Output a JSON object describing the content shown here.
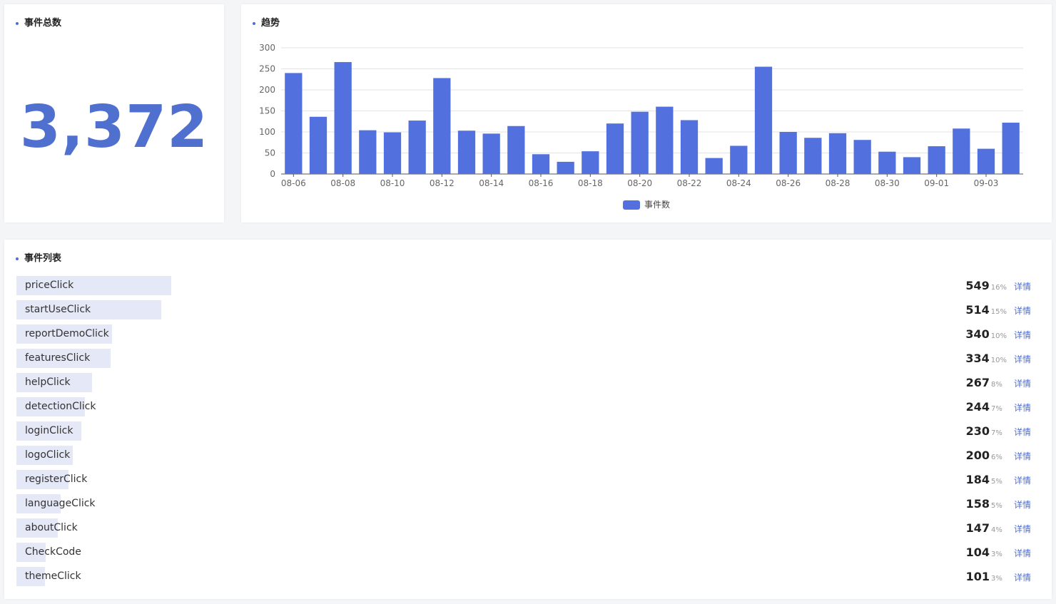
{
  "total_card": {
    "title": "事件总数",
    "value": "3,372"
  },
  "trend_card": {
    "title": "趋势"
  },
  "chart_data": {
    "type": "bar",
    "categories": [
      "08-06",
      "08-07",
      "08-08",
      "08-09",
      "08-10",
      "08-11",
      "08-12",
      "08-13",
      "08-14",
      "08-15",
      "08-16",
      "08-17",
      "08-18",
      "08-19",
      "08-20",
      "08-21",
      "08-22",
      "08-23",
      "08-24",
      "08-25",
      "08-26",
      "08-27",
      "08-28",
      "08-29",
      "08-30",
      "08-31",
      "09-01",
      "09-02",
      "09-03",
      "09-04"
    ],
    "tick_labels": [
      "08-06",
      "08-08",
      "08-10",
      "08-12",
      "08-14",
      "08-16",
      "08-18",
      "08-20",
      "08-22",
      "08-24",
      "08-26",
      "08-28",
      "08-30",
      "09-01",
      "09-03"
    ],
    "series": [
      {
        "name": "事件数",
        "values": [
          240,
          136,
          266,
          104,
          99,
          127,
          228,
          103,
          96,
          114,
          47,
          29,
          54,
          120,
          148,
          160,
          128,
          38,
          67,
          255,
          100,
          86,
          97,
          81,
          53,
          40,
          66,
          108,
          60,
          122
        ]
      }
    ],
    "ylim": [
      0,
      300
    ],
    "yticks": [
      0,
      50,
      100,
      150,
      200,
      250,
      300
    ],
    "grid": true,
    "legend": "bottom-center",
    "color": "#5271de"
  },
  "list_card": {
    "title": "事件列表",
    "detail_label": "详情",
    "max_count": 549,
    "items": [
      {
        "name": "priceClick",
        "count": "549",
        "pct": "16%",
        "value": 549
      },
      {
        "name": "startUseClick",
        "count": "514",
        "pct": "15%",
        "value": 514
      },
      {
        "name": "reportDemoClick",
        "count": "340",
        "pct": "10%",
        "value": 340
      },
      {
        "name": "featuresClick",
        "count": "334",
        "pct": "10%",
        "value": 334
      },
      {
        "name": "helpClick",
        "count": "267",
        "pct": "8%",
        "value": 267
      },
      {
        "name": "detectionClick",
        "count": "244",
        "pct": "7%",
        "value": 244
      },
      {
        "name": "loginClick",
        "count": "230",
        "pct": "7%",
        "value": 230
      },
      {
        "name": "logoClick",
        "count": "200",
        "pct": "6%",
        "value": 200
      },
      {
        "name": "registerClick",
        "count": "184",
        "pct": "5%",
        "value": 184
      },
      {
        "name": "languageClick",
        "count": "158",
        "pct": "5%",
        "value": 158
      },
      {
        "name": "aboutClick",
        "count": "147",
        "pct": "4%",
        "value": 147
      },
      {
        "name": "CheckCode",
        "count": "104",
        "pct": "3%",
        "value": 104
      },
      {
        "name": "themeClick",
        "count": "101",
        "pct": "3%",
        "value": 101
      }
    ]
  }
}
